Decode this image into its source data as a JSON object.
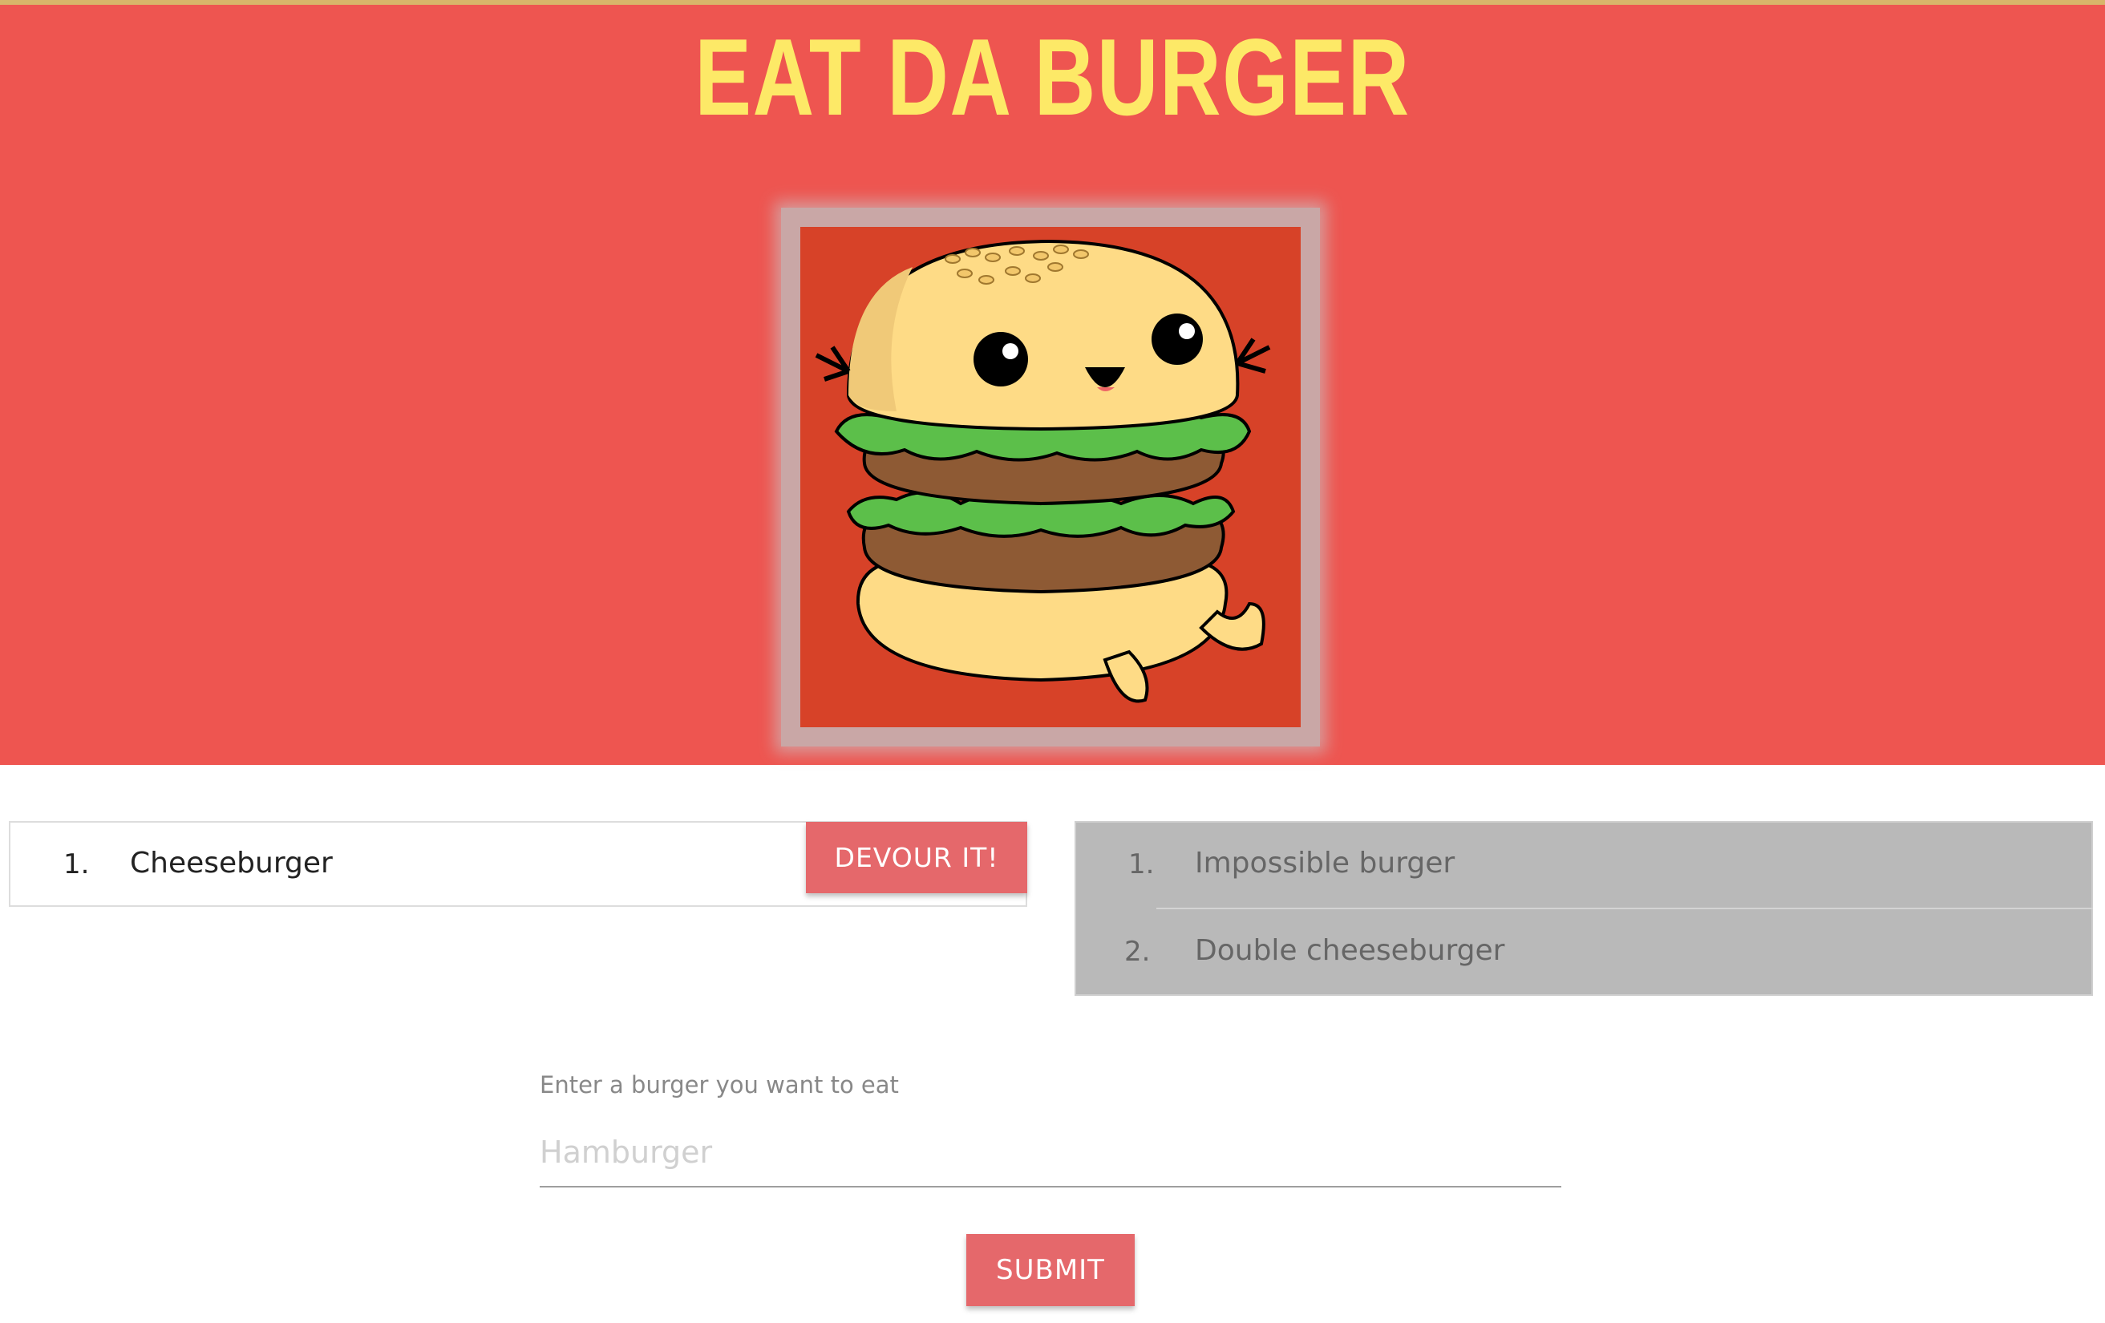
{
  "header": {
    "title": "EAT DA BURGER",
    "image_alt": "Cartoon burger character",
    "colors": {
      "background": "#ee5550",
      "title": "#fde967"
    }
  },
  "uneaten": {
    "items": [
      {
        "number": "1.",
        "name": "Cheeseburger",
        "action_label": "DEVOUR IT!"
      }
    ]
  },
  "devoured": {
    "items": [
      {
        "number": "1.",
        "name": "Impossible burger"
      },
      {
        "number": "2.",
        "name": "Double cheeseburger"
      }
    ]
  },
  "form": {
    "label": "Enter a burger you want to eat",
    "placeholder": "Hamburger",
    "value": "",
    "submit_label": "SUBMIT"
  },
  "colors": {
    "button": "#e5686b",
    "devoured_panel": "#b9b9b9"
  }
}
